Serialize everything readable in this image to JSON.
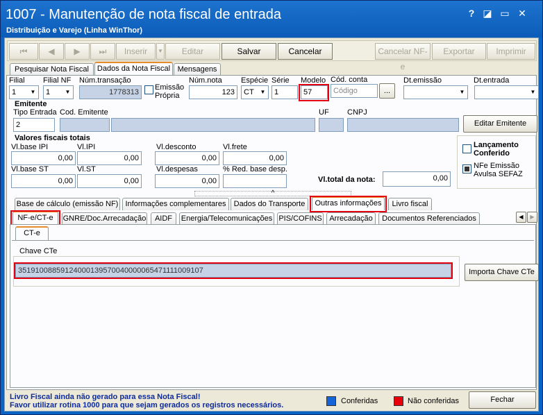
{
  "window": {
    "title": "1007 - Manutenção de nota fiscal de entrada",
    "subtitle": "Distribuição e Varejo (Linha WinThor)",
    "help": "?",
    "restore": "◪",
    "minimize": "▭",
    "close": "✕"
  },
  "toolbar": {
    "first": "⏮",
    "prev": "◀",
    "next": "▶",
    "last": "⏭",
    "inserir": "Inserir",
    "dropdown": "▼",
    "editar": "Editar",
    "salvar": "Salvar",
    "cancelar": "Cancelar",
    "cancelar_nfe": "Cancelar NF-e",
    "exportar": "Exportar",
    "imprimir": "Imprimir"
  },
  "main_tabs": [
    "Pesquisar Nota Fiscal",
    "Dados da Nota Fiscal",
    "Mensagens"
  ],
  "form": {
    "filial_label": "Filial",
    "filial": "1",
    "filial_nf_label": "Filial NF",
    "filial_nf": "1",
    "num_transacao_label": "Núm.transação",
    "num_transacao": "1778313",
    "emissao_propria_1": "Emissão",
    "emissao_propria_2": "Própria",
    "num_nota_label": "Núm.nota",
    "num_nota": "123",
    "especie_label": "Espécie",
    "especie": "CT",
    "serie_label": "Série",
    "serie": "1",
    "modelo_label": "Modelo",
    "modelo": "57",
    "cod_conta_label": "Cód. conta",
    "cod_conta_placeholder": "Código",
    "ellipsis": "...",
    "dt_emissao_label": "Dt.emissão",
    "dt_entrada_label": "Dt.entrada"
  },
  "emitente": {
    "title": "Emitente",
    "tipo_entrada_label": "Tipo Entrada",
    "tipo_entrada": "2",
    "cod_emitente_label": "Cod. Emitente",
    "uf_label": "UF",
    "cnpj_label": "CNPJ",
    "editar_button": "Editar Emitente"
  },
  "valores": {
    "title": "Valores fiscais totais",
    "base_ipi_label": "Vl.base IPI",
    "base_ipi": "0,00",
    "ipi_label": "Vl.IPI",
    "ipi": "0,00",
    "desconto_label": "Vl.desconto",
    "desconto": "0,00",
    "frete_label": "Vl.frete",
    "frete": "0,00",
    "base_st_label": "Vl.base ST",
    "base_st": "0,00",
    "st_label": "Vl.ST",
    "st": "0,00",
    "despesas_label": "Vl.despesas",
    "despesas": "0,00",
    "red_base_label": "% Red. base desp.",
    "total_label": "Vl.total da nota:",
    "total": "0,00"
  },
  "side": {
    "lancamento_1": "Lançamento",
    "lancamento_2": "Conferido",
    "nfe_avulsa_1": "NFe Emissão",
    "nfe_avulsa_2": "Avulsa SEFAZ"
  },
  "tabs_row1": [
    "Base de cálculo (emissão NF)",
    "Informações complementares",
    "Dados do Transporte",
    "Outras informações",
    "Livro fiscal"
  ],
  "tabs_row2": [
    "NF-e/CT-e",
    "GNRE/Doc.Arrecadação",
    "AIDF",
    "Energia/Telecomunicações",
    "PIS/COFINS",
    "Arrecadação",
    "Documentos Referenciados"
  ],
  "tab_nav": {
    "left": "◀",
    "right": "▶"
  },
  "splitter": {
    "up": "^"
  },
  "ct_tab": "CT-e",
  "cte": {
    "chave_label": "Chave CTe",
    "chave": "35191008859124000139570040000065471111009107",
    "importa_button": "Importa Chave CTe"
  },
  "footer": {
    "msg1": "Livro Fiscal ainda não gerado para essa Nota Fiscal!",
    "msg2": "Favor utilizar rotina 1000 para que sejam gerados os registros necessários.",
    "conferidas": "Conferidas",
    "nao_conferidas": "Não conferidas",
    "fechar": "Fechar"
  },
  "colors": {
    "conferidas": "#1565d8",
    "nao_conferidas": "#e8000b",
    "highlight": "#e3000f"
  }
}
